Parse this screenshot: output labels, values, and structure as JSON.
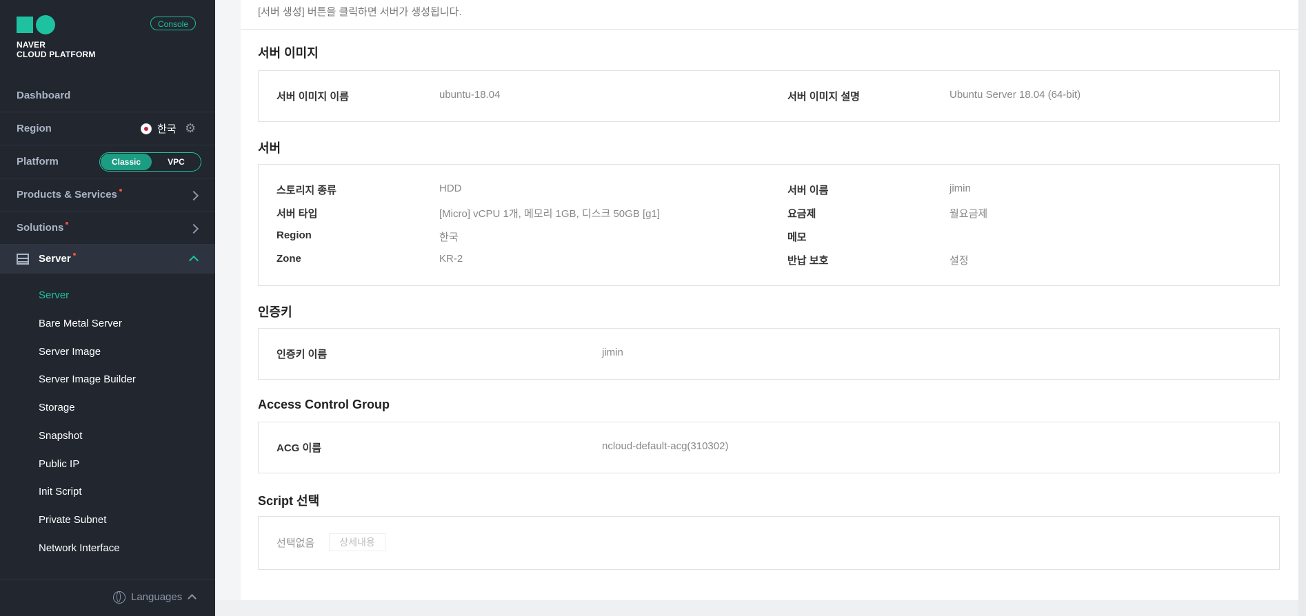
{
  "brand": {
    "line1": "NAVER",
    "line2": "CLOUD PLATFORM",
    "console_badge": "Console"
  },
  "sidebar": {
    "dashboard": "Dashboard",
    "region_label": "Region",
    "region_value": "한국",
    "platform_label": "Platform",
    "platform_options": [
      "Classic",
      "VPC"
    ],
    "platform_selected": "Classic",
    "products": "Products & Services",
    "solutions": "Solutions",
    "server_group": "Server",
    "server_items": [
      "Server",
      "Bare Metal Server",
      "Server Image",
      "Server Image Builder",
      "Storage",
      "Snapshot",
      "Public IP",
      "Init Script",
      "Private Subnet",
      "Network Interface"
    ],
    "active_item": "Server",
    "languages": "Languages"
  },
  "main": {
    "hint": "[서버 생성] 버튼을 클릭하면 서버가 생성됩니다.",
    "server_image": {
      "title": "서버 이미지",
      "name_label": "서버 이미지 이름",
      "name_value": "ubuntu-18.04",
      "desc_label": "서버 이미지 설명",
      "desc_value": "Ubuntu Server 18.04 (64-bit)"
    },
    "server": {
      "title": "서버",
      "storage_label": "스토리지 종류",
      "storage_value": "HDD",
      "name_label": "서버 이름",
      "name_value": "jimin",
      "type_label": "서버 타입",
      "type_value": "[Micro] vCPU 1개, 메모리 1GB, 디스크 50GB [g1]",
      "plan_label": "요금제",
      "plan_value": "월요금제",
      "region_label": "Region",
      "region_value": "한국",
      "memo_label": "메모",
      "zone_label": "Zone",
      "zone_value": "KR-2",
      "protect_label": "반납 보호",
      "protect_value": "설정"
    },
    "auth_key": {
      "title": "인증키",
      "name_label": "인증키 이름",
      "name_value": "jimin"
    },
    "acg": {
      "title": "Access Control Group",
      "name_label": "ACG 이름",
      "name_value": "ncloud-default-acg(310302)"
    },
    "script": {
      "title": "Script 선택",
      "value": "선택없음",
      "detail_button": "상세내용"
    }
  },
  "colors": {
    "sidebar_bg": "#21262f",
    "accent": "#1ec2a0",
    "alert_dot": "#f0513c"
  }
}
